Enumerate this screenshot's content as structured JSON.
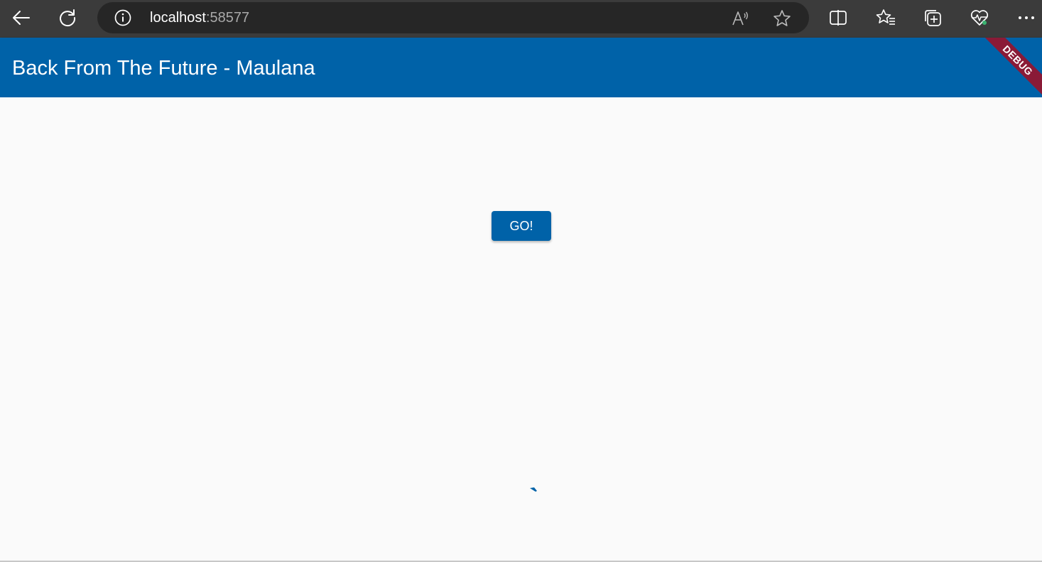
{
  "browser": {
    "address": {
      "host": "localhost",
      "port": ":58577"
    },
    "icons": [
      "back-icon",
      "refresh-icon",
      "info-icon",
      "read-aloud-icon",
      "favorite-star-icon",
      "split-screen-icon",
      "favorites-icon",
      "collections-icon",
      "browser-essentials-icon",
      "more-icon"
    ]
  },
  "app": {
    "title": "Back From The Future - Maulana",
    "debug_banner": "DEBUG",
    "go_button_label": "GO!",
    "loading": true
  },
  "colors": {
    "toolbar": "#3b3b3b",
    "address_bar": "#262626",
    "app_bar": "#0062a8",
    "debug_banner": "#8a1a37",
    "background": "#fafafa"
  }
}
